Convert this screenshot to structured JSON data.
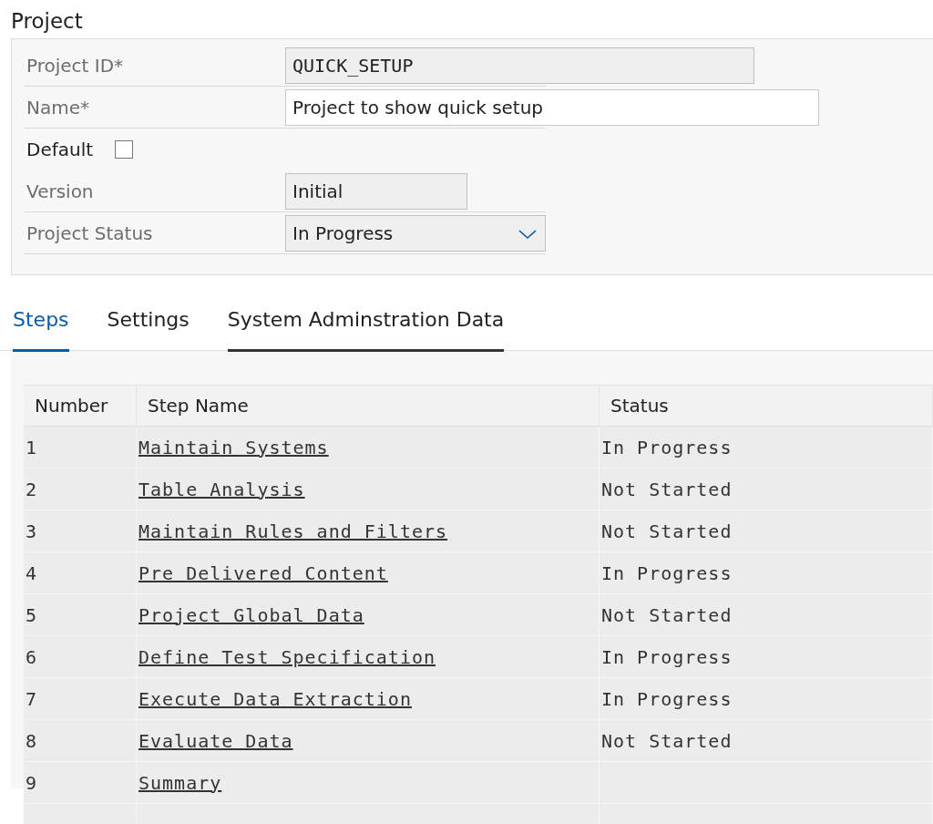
{
  "section_title": "Project",
  "fields": [
    {
      "kind": "text",
      "label": "Project ID*",
      "value": "QUICK_SETUP",
      "readonly": true,
      "mono": true
    },
    {
      "kind": "text",
      "label": "Name*",
      "value": "Project to show quick setup",
      "readonly": false,
      "mono": false
    },
    {
      "kind": "checkbox",
      "label": "Default",
      "checked": false
    },
    {
      "kind": "text",
      "label": "Version",
      "value": "Initial",
      "readonly": true,
      "mono": false
    },
    {
      "kind": "select",
      "label": "Project Status",
      "value": "In Progress"
    }
  ],
  "tabs": [
    {
      "label": "Steps",
      "selected": true,
      "hovered": false
    },
    {
      "label": "Settings",
      "selected": false,
      "hovered": false
    },
    {
      "label": "System Adminstration Data",
      "selected": false,
      "hovered": true
    }
  ],
  "table": {
    "columns": [
      "Number",
      "Step Name",
      "Status"
    ],
    "rows": [
      {
        "number": "1",
        "step": "Maintain Systems",
        "status": "In Progress"
      },
      {
        "number": "2",
        "step": "Table Analysis",
        "status": "Not Started"
      },
      {
        "number": "3",
        "step": "Maintain Rules and Filters",
        "status": "Not Started"
      },
      {
        "number": "4",
        "step": "Pre Delivered Content",
        "status": "In Progress"
      },
      {
        "number": "5",
        "step": "Project Global Data",
        "status": "Not Started"
      },
      {
        "number": "6",
        "step": "Define Test Specification",
        "status": "In Progress"
      },
      {
        "number": "7",
        "step": "Execute Data Extraction",
        "status": "In Progress"
      },
      {
        "number": "8",
        "step": "Evaluate Data",
        "status": "Not Started"
      },
      {
        "number": "9",
        "step": "Summary"
      }
    ]
  }
}
